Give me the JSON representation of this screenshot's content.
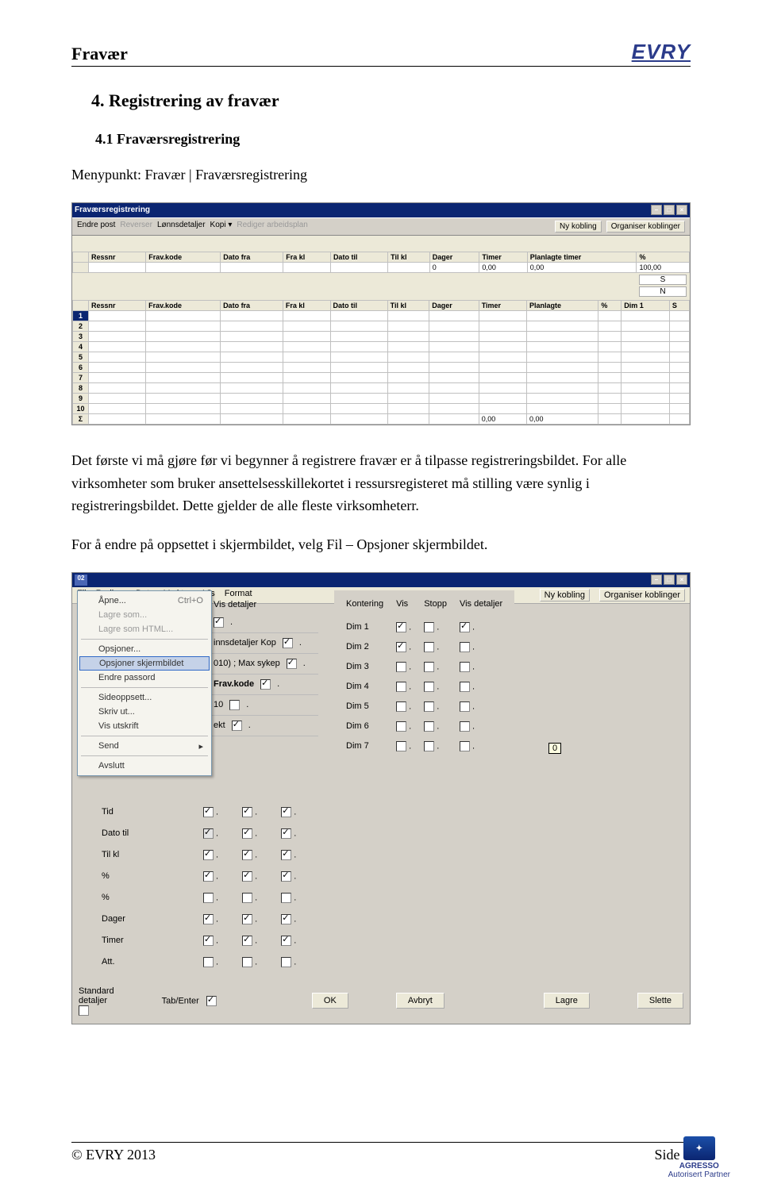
{
  "header": {
    "title": "Fravær",
    "logo": "EVRY"
  },
  "section": {
    "h1": "4. Registrering av fravær",
    "h2": "4.1 Fraværsregistrering",
    "menypunkt": "Menypunkt: Fravær | Fraværsregistrering",
    "body1": "Det første vi må gjøre før vi begynner å registrere fravær er å tilpasse registreringsbildet. For alle virksomheter som bruker ansettelsesskillekortet i ressursregisteret må stilling være synlig i registreringsbildet. Dette gjelder de alle fleste virksomheterr.",
    "body2": "For å endre på oppsettet i skjermbildet, velg Fil – Opsjoner skjermbildet."
  },
  "shot1": {
    "title": "Fraværsregistrering",
    "menu": [
      "Endre post",
      "Reverser",
      "Lønnsdetaljer",
      "Kopi ▾",
      "Rediger arbeidsplan"
    ],
    "toolbtns": [
      "Ny kobling",
      "Organiser koblinger"
    ],
    "cols_top": [
      "Ressnr",
      "Frav.kode",
      "Dato fra",
      "Fra kl",
      "Dato til",
      "Til kl",
      "Dager",
      "Timer",
      "Planlagte timer",
      "%"
    ],
    "top_row": [
      "",
      "",
      "",
      "",
      "",
      "",
      "0",
      "0,00",
      "0,00",
      "100,00"
    ],
    "top_tail": [
      "S",
      "N"
    ],
    "cols_bot": [
      "Ressnr",
      "Frav.kode",
      "Dato fra",
      "Fra kl",
      "Dato til",
      "Til kl",
      "Dager",
      "Timer",
      "Planlagte",
      "%",
      "Dim 1",
      "S"
    ],
    "sum_timer": "0,00",
    "sum_plan": "0,00",
    "rowcount": 10
  },
  "shot2": {
    "topmenu": [
      "Fil",
      "Rediger",
      "Data",
      "Verktøy",
      "Vis",
      "Format"
    ],
    "topbtns": [
      "Ny kobling",
      "Organiser koblinger"
    ],
    "filemenu": [
      {
        "t": "Åpne...",
        "sc": "Ctrl+O"
      },
      {
        "t": "Lagre som...",
        "dis": true
      },
      {
        "t": "Lagre som HTML...",
        "dis": true
      },
      {
        "sep": true
      },
      {
        "t": "Opsjoner..."
      },
      {
        "t": "Opsjoner skjermbildet",
        "sel": true
      },
      {
        "t": "Endre passord"
      },
      {
        "sep": true
      },
      {
        "t": "Sideoppsett..."
      },
      {
        "t": "Skriv ut..."
      },
      {
        "t": "Vis utskrift"
      },
      {
        "sep": true
      },
      {
        "t": "Send",
        "arrow": true
      },
      {
        "sep": true
      },
      {
        "t": "Avslutt"
      }
    ],
    "mid_fragments": [
      "innsdetaljer  Kop",
      "010) ; Max sykep",
      "Frav.kode",
      "10",
      "ekt"
    ],
    "mid_header": "Vis detaljer",
    "right_cols": [
      "Kontering",
      "Vis",
      "Stopp",
      "Vis detaljer"
    ],
    "dims": [
      {
        "n": "Dim 1",
        "v": true,
        "s": false,
        "d": true
      },
      {
        "n": "Dim 2",
        "v": true,
        "s": false,
        "d": false
      },
      {
        "n": "Dim 3",
        "v": false,
        "s": false,
        "d": false
      },
      {
        "n": "Dim 4",
        "v": false,
        "s": false,
        "d": false
      },
      {
        "n": "Dim 5",
        "v": false,
        "s": false,
        "d": false
      },
      {
        "n": "Dim 6",
        "v": false,
        "s": false,
        "d": false
      },
      {
        "n": "Dim 7",
        "v": false,
        "s": false,
        "d": false
      }
    ],
    "left_rows": [
      {
        "n": "Tid",
        "a": true,
        "b": true,
        "c": true
      },
      {
        "n": "Dato til",
        "a": true,
        "b": true,
        "c": true,
        "adis": true
      },
      {
        "n": "Til kl",
        "a": true,
        "b": true,
        "c": true
      },
      {
        "n": "%",
        "a": true,
        "b": true,
        "c": true
      },
      {
        "n": "%",
        "a": false,
        "b": false,
        "c": false
      },
      {
        "n": "Dager",
        "a": true,
        "b": true,
        "c": true
      },
      {
        "n": "Timer",
        "a": true,
        "b": true,
        "c": true
      },
      {
        "n": "Att.",
        "a": false,
        "b": false,
        "c": false
      }
    ],
    "bottom": {
      "sd_label": "Standard detaljer",
      "te_label": "Tab/Enter",
      "ok": "OK",
      "cancel": "Avbryt",
      "save": "Lagre",
      "del": "Slette"
    },
    "zero_box": "0"
  },
  "footer": {
    "left": "© EVRY 2013",
    "right": "Side 8",
    "agresso_label": "Autorisert Partner",
    "agresso_name": "AGRESSO"
  }
}
